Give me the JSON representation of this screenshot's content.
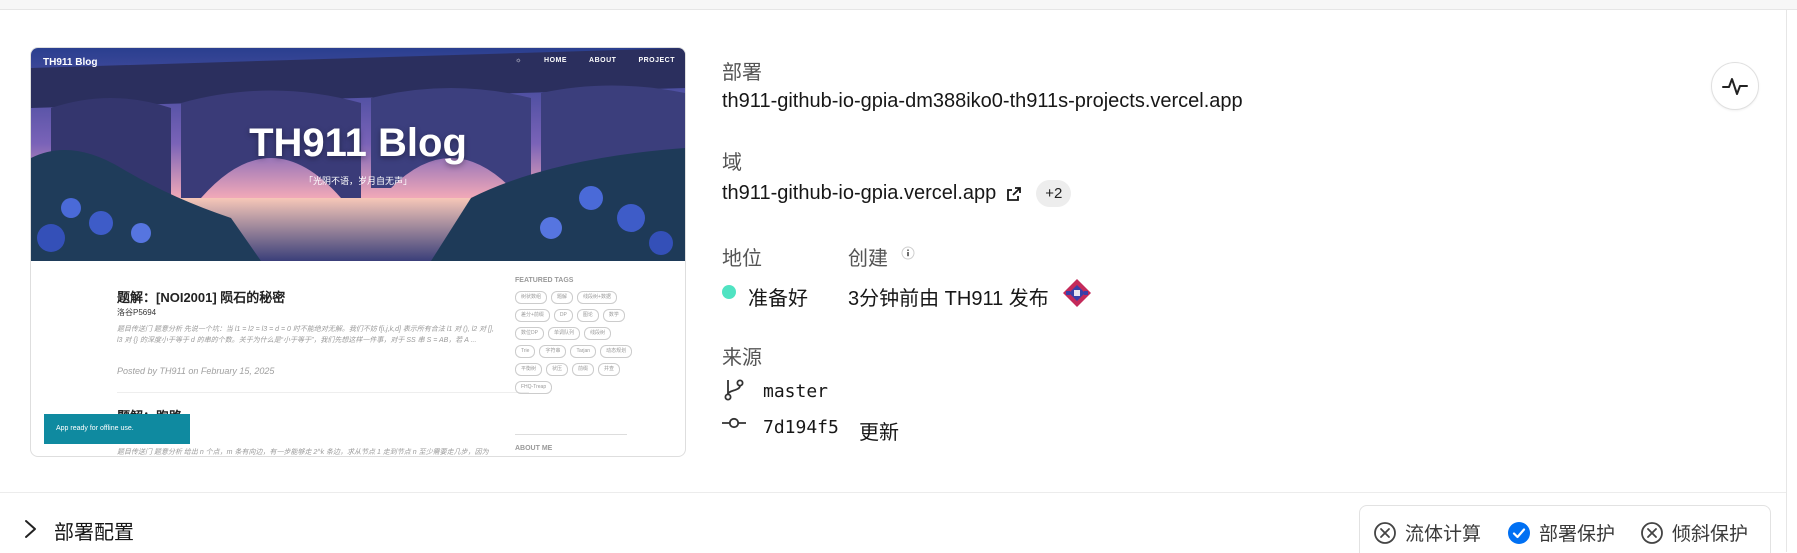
{
  "preview": {
    "site_logo": "TH911 Blog",
    "nav": [
      "HOME",
      "ABOUT",
      "PROJECT"
    ],
    "hero_title": "TH911 Blog",
    "hero_subtitle": "「光阴不语，岁月自无声」",
    "post_title": "题解：[NOI2001] 陨石的秘密",
    "post_source": "洛谷P5694",
    "post_excerpt": "题目传送门 题意分析 先说一个坑：当 l1 = l2 = l3 = d = 0 时不能绝对无解。我们不妨 f[i,j,k,d] 表示所有合法 l1 对 (), l2 对 [], l3 对 {} 的深度小于等于 d 的串的个数。关于为什么是“小于等于”，我们先想这样一件事，对于 SS 串 S = AB，若 A ...",
    "post_meta": "Posted by TH911 on February 15, 2025",
    "post2_title": "题解：跑路",
    "post2_excerpt": "题目传送门 题意分析 给出 n 个点，m 条有向边，有一步能够走 2^k 条边，求从节点 1 走到节点 n 至少需要走几步，因为",
    "featured_tags_heading": "FEATURED TAGS",
    "tags": [
      "树状数组",
      "题解",
      "线段树+数据",
      "差分+前缀",
      "DP",
      "图论",
      "数学",
      "数位DP",
      "单调队列",
      "线段树",
      "Trie",
      "字符串",
      "Tarjan",
      "动态规划",
      "平衡树",
      "状压",
      "前缀",
      "并查",
      "FHQ-Treap"
    ],
    "about_heading": "ABOUT ME",
    "toast": "App ready for offline use."
  },
  "deployment": {
    "label": "部署",
    "url": "th911-github-io-gpia-dm388iko0-th911s-projects.vercel.app"
  },
  "domains": {
    "label": "域",
    "primary": "th911-github-io-gpia.vercel.app",
    "extra_count": "+2"
  },
  "status": {
    "label": "地位",
    "value": "准备好",
    "color": "#50e3c2"
  },
  "created": {
    "label": "创建",
    "value": "3分钟前由 TH911 发布"
  },
  "source": {
    "label": "来源",
    "branch": "master",
    "commit_hash": "7d194f5",
    "commit_message": "更新"
  },
  "config": {
    "label": "部署配置"
  },
  "protections": [
    {
      "label": "流体计算",
      "icon": "x-circle-icon",
      "enabled": false
    },
    {
      "label": "部署保护",
      "icon": "check-circle-icon",
      "enabled": true
    },
    {
      "label": "倾斜保护",
      "icon": "x-circle-icon",
      "enabled": false
    }
  ],
  "colors": {
    "accent_blue": "#0070f3",
    "status_ready": "#50e3c2",
    "toast_bg": "#0f8aa0"
  }
}
